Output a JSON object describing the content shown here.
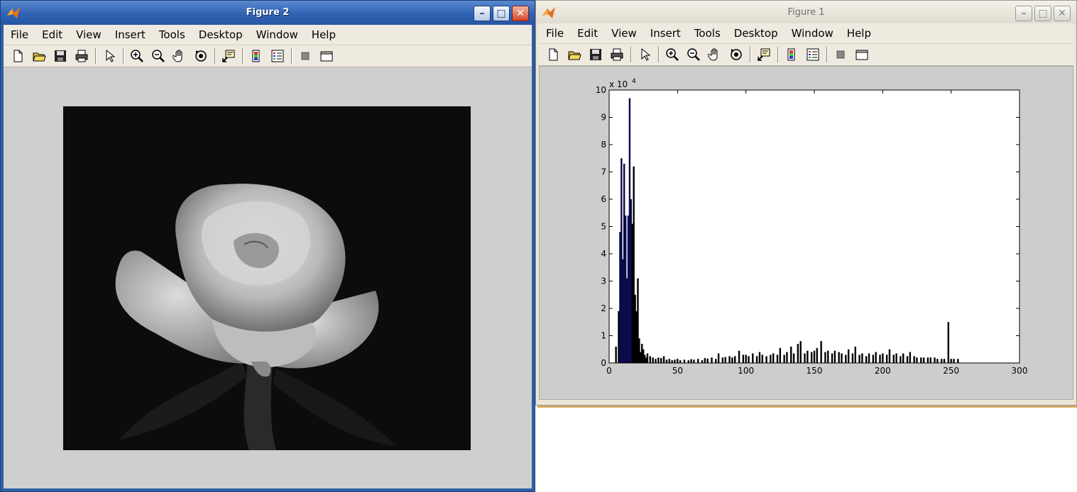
{
  "figure2": {
    "title": "Figure 2",
    "menus": [
      "File",
      "Edit",
      "View",
      "Insert",
      "Tools",
      "Desktop",
      "Window",
      "Help"
    ],
    "window_buttons": {
      "minimize": "–",
      "maximize": "□",
      "close": "✕"
    }
  },
  "figure1": {
    "title": "Figure 1",
    "menus": [
      "File",
      "Edit",
      "View",
      "Insert",
      "Tools",
      "Desktop",
      "Window",
      "Help"
    ],
    "window_buttons": {
      "minimize": "–",
      "maximize": "□",
      "close": "✕"
    }
  },
  "toolbar_icons": [
    "new-file-icon",
    "open-folder-icon",
    "save-icon",
    "print-icon",
    "select-arrow-icon",
    "zoom-in-icon",
    "zoom-out-icon",
    "pan-hand-icon",
    "rotate-3d-icon",
    "data-cursor-icon",
    "colorbar-icon",
    "legend-icon",
    "hide-plot-tools-icon",
    "show-plot-tools-icon"
  ],
  "colors": {
    "titlebar_active": "#2f62b3",
    "titlebar_inactive": "#dedad0",
    "bars": "#000000",
    "bars_dark_blue": "#0b0b4a"
  },
  "chart_data": {
    "type": "bar",
    "exponent_label": "x 10",
    "exponent_power": "4",
    "xlim": [
      0,
      300
    ],
    "ylim": [
      0,
      10
    ],
    "x_ticks": [
      "0",
      "50",
      "100",
      "150",
      "200",
      "250",
      "300"
    ],
    "y_ticks": [
      "0",
      "1",
      "2",
      "3",
      "4",
      "5",
      "6",
      "7",
      "8",
      "9",
      "10"
    ],
    "grid": false,
    "x": [
      5,
      7,
      8,
      9,
      10,
      11,
      12,
      13,
      14,
      15,
      16,
      17,
      18,
      19,
      20,
      21,
      22,
      23,
      24,
      25,
      26,
      27,
      28,
      30,
      32,
      34,
      36,
      38,
      40,
      42,
      44,
      46,
      48,
      50,
      52,
      55,
      58,
      60,
      62,
      65,
      68,
      70,
      72,
      75,
      78,
      80,
      83,
      85,
      88,
      90,
      92,
      95,
      98,
      100,
      102,
      105,
      108,
      110,
      112,
      115,
      118,
      120,
      123,
      125,
      128,
      130,
      133,
      135,
      138,
      140,
      143,
      145,
      148,
      150,
      152,
      155,
      158,
      160,
      163,
      165,
      168,
      170,
      173,
      175,
      178,
      180,
      183,
      185,
      188,
      190,
      193,
      195,
      198,
      200,
      203,
      205,
      208,
      210,
      213,
      215,
      218,
      220,
      223,
      225,
      228,
      230,
      233,
      235,
      238,
      240,
      243,
      245,
      248,
      250,
      252,
      255
    ],
    "values": [
      0.6,
      1.9,
      4.8,
      7.5,
      3.8,
      7.3,
      5.4,
      3.1,
      5.4,
      9.7,
      6.0,
      5.1,
      7.2,
      2.5,
      1.9,
      3.1,
      0.9,
      0.4,
      0.7,
      0.5,
      0.3,
      0.2,
      0.35,
      0.25,
      0.2,
      0.15,
      0.2,
      0.18,
      0.25,
      0.12,
      0.15,
      0.1,
      0.12,
      0.15,
      0.1,
      0.12,
      0.1,
      0.14,
      0.12,
      0.15,
      0.1,
      0.18,
      0.16,
      0.2,
      0.15,
      0.35,
      0.2,
      0.22,
      0.25,
      0.2,
      0.25,
      0.45,
      0.3,
      0.3,
      0.25,
      0.35,
      0.25,
      0.4,
      0.3,
      0.25,
      0.3,
      0.35,
      0.3,
      0.55,
      0.3,
      0.4,
      0.6,
      0.35,
      0.7,
      0.8,
      0.35,
      0.45,
      0.4,
      0.45,
      0.55,
      0.8,
      0.4,
      0.45,
      0.35,
      0.45,
      0.4,
      0.35,
      0.3,
      0.5,
      0.35,
      0.6,
      0.3,
      0.35,
      0.25,
      0.35,
      0.3,
      0.4,
      0.3,
      0.35,
      0.3,
      0.5,
      0.3,
      0.35,
      0.25,
      0.35,
      0.25,
      0.4,
      0.25,
      0.2,
      0.2,
      0.2,
      0.2,
      0.2,
      0.2,
      0.15,
      0.15,
      0.15,
      1.5,
      0.15,
      0.15,
      0.15
    ]
  }
}
